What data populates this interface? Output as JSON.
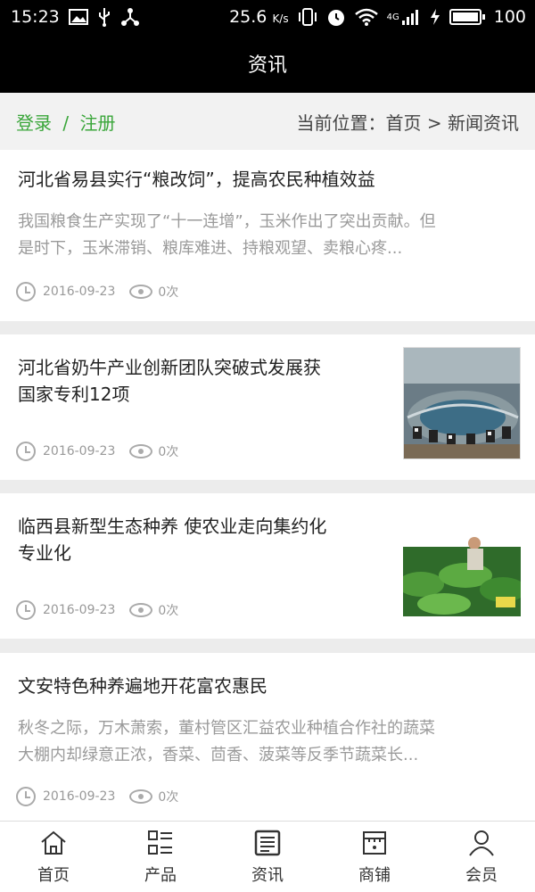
{
  "status_bar": {
    "time": "15:23",
    "speed": "25.6",
    "speed_unit": "K/s",
    "network": "4G",
    "battery": "100",
    "icons": [
      "image-icon",
      "usb-icon",
      "share-icon",
      "vibrate-icon",
      "alarm-icon",
      "wifi-icon",
      "signal-icon",
      "charging-icon",
      "battery-icon"
    ]
  },
  "header": {
    "title": "资讯"
  },
  "breadcrumb": {
    "login": "登录",
    "separator": "/",
    "register": "注册",
    "location_label": "当前位置：",
    "path": "首页 > 新闻资讯"
  },
  "articles": [
    {
      "title": "河北省易县实行“粮改饲”，提高农民种植效益",
      "summary_line1": "我国粮食生产实现了“十一连增”，玉米作出了突出贡献。但",
      "summary_line2": "是时下，玉米滞销、粮库难进、持粮观望、卖粮心疼...",
      "date": "2016-09-23",
      "views": "0次"
    },
    {
      "title_line1": "河北省奶牛产业创新团队突破式发展获",
      "title_line2": "国家专利12项",
      "date": "2016-09-23",
      "views": "0次"
    },
    {
      "title_line1": "临西县新型生态种养 使农业走向集约化",
      "title_line2": "专业化",
      "date": "2016-09-23",
      "views": "0次"
    },
    {
      "title": "文安特色种养遍地开花富农惠民",
      "summary_line1": "秋冬之际，万木萧索，董村管区汇益农业种植合作社的蔬菜",
      "summary_line2": "大棚内却绿意正浓，香菜、茴香、菠菜等反季节蔬菜长...",
      "date": "2016-09-23",
      "views": "0次"
    }
  ],
  "tabs": [
    {
      "label": "首页",
      "icon": "home-icon"
    },
    {
      "label": "产品",
      "icon": "list-icon"
    },
    {
      "label": "资讯",
      "icon": "news-icon"
    },
    {
      "label": "商铺",
      "icon": "store-icon"
    },
    {
      "label": "会员",
      "icon": "user-icon"
    }
  ],
  "colors": {
    "accent": "#3aa63a",
    "header_bg": "#000000"
  }
}
